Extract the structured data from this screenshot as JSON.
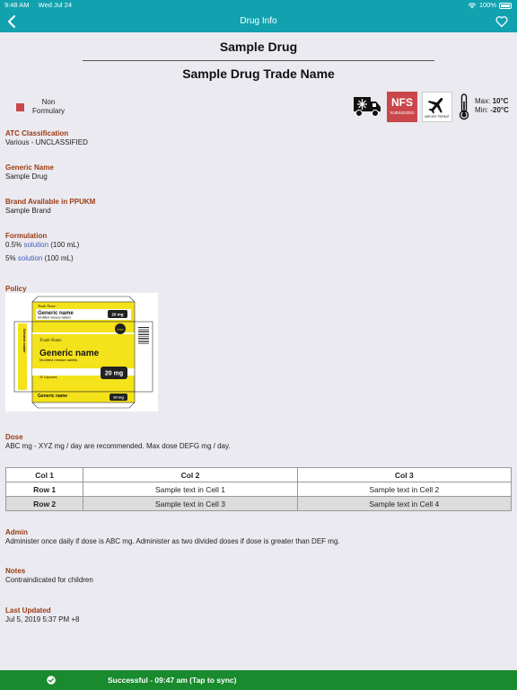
{
  "status_bar": {
    "time": "9:48 AM",
    "date": "Wed Jul 24",
    "battery": "100%"
  },
  "nav": {
    "title": "Drug Info"
  },
  "drug": {
    "name": "Sample Drug",
    "trade_name": "Sample Drug Trade Name"
  },
  "formulary": {
    "line1": "Non",
    "line2": "Formulary",
    "color": "#c9474b"
  },
  "badges": {
    "nfs_big": "NFS",
    "nfs_small": "SUBSIDIZED",
    "import_small": "IMPORT PERMIT",
    "temp_max_label": "Max:",
    "temp_max": "10°C",
    "temp_min_label": "Min:",
    "temp_min": "-20°C"
  },
  "sections": {
    "atc": {
      "label": "ATC Classification",
      "value": "Various - UNCLASSIFIED"
    },
    "generic": {
      "label": "Generic Name",
      "value": "Sample Drug"
    },
    "brand": {
      "label": "Brand Available in PPUKM",
      "value": "Sample Brand"
    },
    "formulation": {
      "label": "Formulation",
      "items": [
        {
          "pre": "0.5% ",
          "link": "solution",
          "post": " (100 mL)"
        },
        {
          "pre": "5% ",
          "link": "solution",
          "post": " (100 mL)"
        }
      ]
    },
    "policy": {
      "label": "Policy",
      "image_text": {
        "trade": "Trade Name",
        "generic": "Generic name",
        "sub": "Modified release tablets",
        "dose": "20 mg",
        "logo": "Logo",
        "count": "30 Capsules"
      }
    },
    "dose": {
      "label": "Dose",
      "value": "ABC mg - XYZ mg / day are recommended. Max dose DEFG mg / day."
    },
    "admin": {
      "label": "Admin",
      "value": "Administer once daily if dose is ABC mg. Administer as two divided doses if dose is greater than DEF mg."
    },
    "notes": {
      "label": "Notes",
      "value": "Contraindicated for children"
    },
    "updated": {
      "label": "Last Updated",
      "value": "Jul 5, 2019 5:37 PM +8"
    }
  },
  "table": {
    "headers": [
      "Col 1",
      "Col 2",
      "Col 3"
    ],
    "rows": [
      [
        "Row 1",
        "Sample text in Cell 1",
        "Sample text in Cell 2"
      ],
      [
        "Row 2",
        "Sample text in Cell 3",
        "Sample text in Cell 4"
      ]
    ]
  },
  "sync": {
    "text": "Successful - 09:47 am (Tap to sync)",
    "color": "#1a8a2e"
  },
  "colors": {
    "teal": "#12a2af",
    "label": "#9a3b13",
    "link": "#3f5fbf"
  }
}
